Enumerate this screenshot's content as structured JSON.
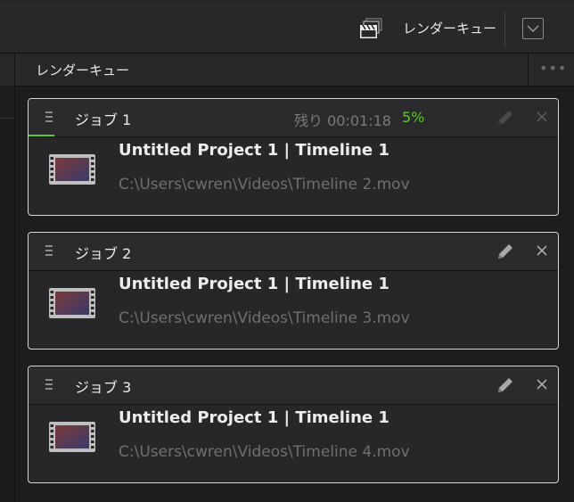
{
  "topbar": {
    "render_queue_label": "レンダーキュー",
    "icon": "clapperboard-icon",
    "dropdown_icon": "chevron-down-icon"
  },
  "panel": {
    "title": "レンダーキュー",
    "more_icon": "ellipsis-icon"
  },
  "jobs": [
    {
      "name": "ジョブ 1",
      "remaining": "残り 00:01:18",
      "percent": "5%",
      "progress": 0.05,
      "title": "Untitled Project 1 | Timeline 1",
      "path": "C:\\Users\\cwren\\Videos\\Timeline 2.mov"
    },
    {
      "name": "ジョブ 2",
      "title": "Untitled Project 1 | Timeline 1",
      "path": "C:\\Users\\cwren\\Videos\\Timeline 3.mov"
    },
    {
      "name": "ジョブ 3",
      "title": "Untitled Project 1 | Timeline 1",
      "path": "C:\\Users\\cwren\\Videos\\Timeline 4.mov"
    }
  ],
  "colors": {
    "progress_green": "#5fc82b",
    "card_border": "#d6d6d6",
    "background": "#1d1d1f"
  }
}
